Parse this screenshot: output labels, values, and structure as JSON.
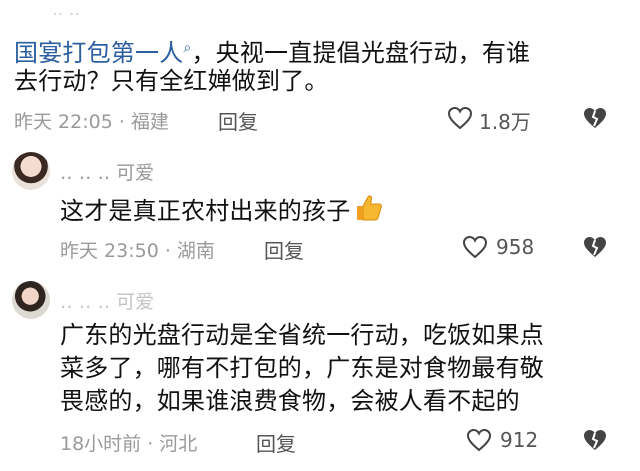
{
  "top_faded": "‥ ‥",
  "comments": [
    {
      "mention": "国宴打包第一人",
      "text_after_mention": "，央视一直提倡光盘行动，有谁",
      "line2": "去行动？只有全红婵做到了。",
      "meta": "昨天 22:05 · 福建",
      "reply": "回复",
      "likes": "1.8万"
    },
    {
      "username": "‥ ‥ ‥ 可爱",
      "text": "这才是真正农村出来的孩子",
      "emoji": "thumbs-up",
      "meta": "昨天 23:50 · 湖南",
      "reply": "回复",
      "likes": "958"
    },
    {
      "username": "‥ ‥ ‥ 可爱",
      "line1": "广东的光盘行动是全省统一行动，吃饭如果点",
      "line2": "菜多了，哪有不打包的，广东是对食物最有敬",
      "line3": "畏感的，如果谁浪费食物，会被人看不起的",
      "meta": "18小时前 · 河北",
      "reply": "回复",
      "likes": "912"
    }
  ],
  "colors": {
    "link": "#2c5fa0",
    "meta": "#9a9a9a"
  }
}
